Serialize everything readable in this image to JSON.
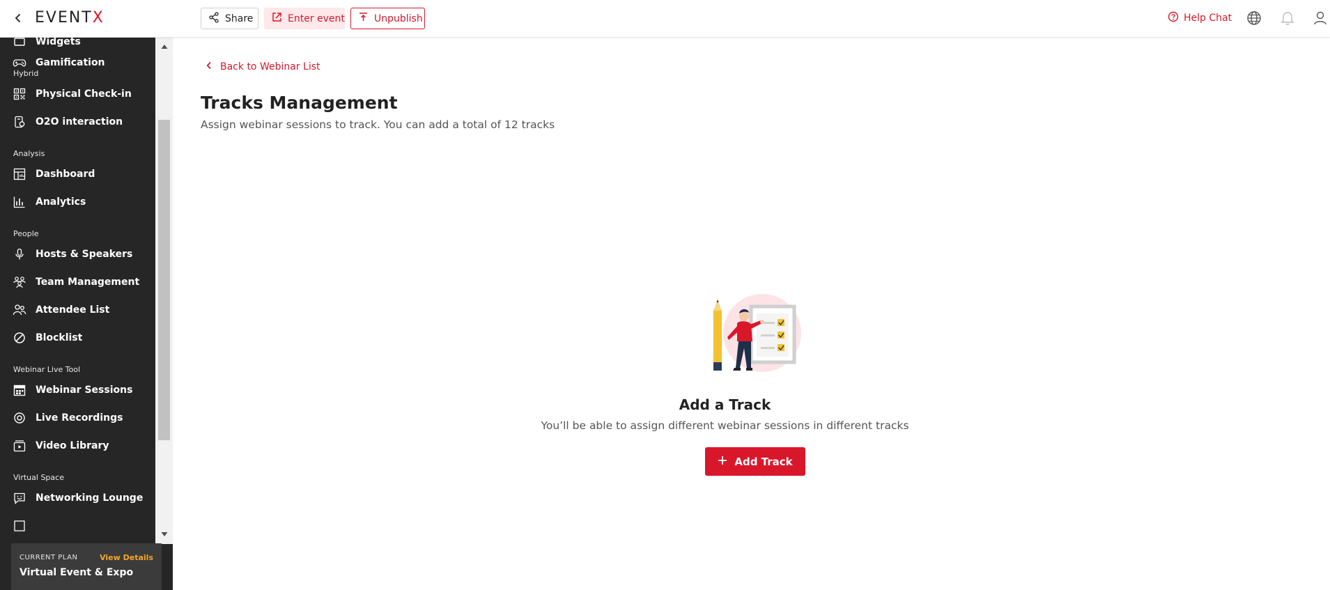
{
  "header": {
    "logo_text": "EVENT",
    "logo_accent": "X",
    "share_label": "Share",
    "enter_event_label": "Enter event",
    "unpublish_label": "Unpublish",
    "help_chat_label": "Help Chat",
    "icons": [
      "back-chevron-icon",
      "share-icon",
      "external-link-icon",
      "unpublish-icon",
      "help-circle-icon",
      "globe-icon",
      "bell-icon",
      "user-icon"
    ]
  },
  "sidebar": {
    "items": [
      {
        "label": "Widgets",
        "icon": "widget-icon"
      },
      {
        "label": "Gamification",
        "icon": "gamepad-icon"
      },
      {
        "section": "Hybrid"
      },
      {
        "label": "Physical Check-in",
        "icon": "qr-code-icon"
      },
      {
        "label": "O2O interaction",
        "icon": "device-icon"
      },
      {
        "section": "Analysis"
      },
      {
        "label": "Dashboard",
        "icon": "dashboard-icon"
      },
      {
        "label": "Analytics",
        "icon": "bar-chart-icon"
      },
      {
        "section": "People"
      },
      {
        "label": "Hosts & Speakers",
        "icon": "microphone-icon"
      },
      {
        "label": "Team Management",
        "icon": "team-icon"
      },
      {
        "label": "Attendee List",
        "icon": "attendees-icon"
      },
      {
        "label": "Blocklist",
        "icon": "block-icon"
      },
      {
        "section": "Webinar Live Tool"
      },
      {
        "label": "Webinar Sessions",
        "icon": "calendar-grid-icon"
      },
      {
        "label": "Live Recordings",
        "icon": "record-icon"
      },
      {
        "label": "Video Library",
        "icon": "video-library-icon"
      },
      {
        "section": "Virtual Space"
      },
      {
        "label": "Networking Lounge",
        "icon": "chat-smile-icon"
      }
    ],
    "plan": {
      "label": "CURRENT PLAN",
      "link": "View Details",
      "name": "Virtual Event & Expo"
    }
  },
  "main": {
    "back_link": "Back to Webinar List",
    "title": "Tracks Management",
    "subtitle": "Assign webinar sessions to track. You can add a total of 12 tracks",
    "empty_state": {
      "title": "Add a Track",
      "description": "You’ll be able to assign different webinar sessions in different tracks",
      "button_label": "Add Track"
    }
  },
  "colors": {
    "accent": "#d9172a",
    "sidebar_bg": "#262626",
    "plan_link": "#f5a623"
  }
}
